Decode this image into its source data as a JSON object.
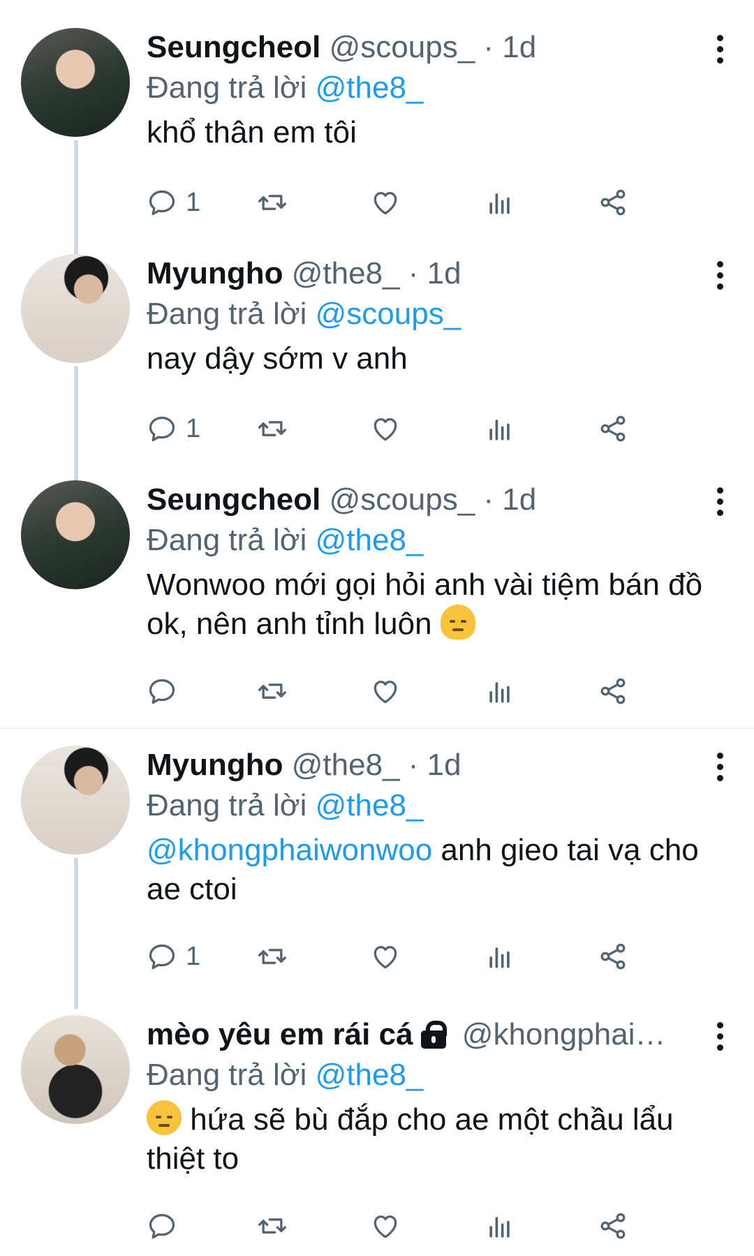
{
  "replying_prefix": "Đang trả lời",
  "colors": {
    "accent": "#1d9bf0",
    "secondary_text": "#536471",
    "icon": "#536471"
  },
  "tweets": [
    {
      "name": "Seungcheol",
      "handle": "@scoups_",
      "sep": "·",
      "time": "1d",
      "replying_to": "@the8_",
      "mention": "",
      "text": "khổ thân em tôi",
      "reply_count": "1",
      "avatar_icon": "profile-photo"
    },
    {
      "name": "Myungho",
      "handle": "@the8_",
      "sep": "·",
      "time": "1d",
      "replying_to": "@scoups_",
      "mention": "",
      "text": "nay dậy sớm v anh",
      "reply_count": "1",
      "avatar_icon": "profile-photo"
    },
    {
      "name": "Seungcheol",
      "handle": "@scoups_",
      "sep": "·",
      "time": "1d",
      "replying_to": "@the8_",
      "mention": "",
      "text": "Wonwoo mới gọi hỏi anh vài tiệm bán đồ ok, nên anh tỉnh luôn",
      "emoji_after": "melting-face-emoji",
      "reply_count": "",
      "avatar_icon": "profile-photo"
    },
    {
      "name": "Myungho",
      "handle": "@the8_",
      "sep": "·",
      "time": "1d",
      "replying_to": "@the8_",
      "mention": "@khongphaiwonwoo",
      "text": " anh gieo tai vạ cho ae ctoi",
      "reply_count": "1",
      "avatar_icon": "profile-photo"
    },
    {
      "name": "mèo yêu em rái cá",
      "handle": "@khongphai…",
      "sep": "",
      "time": "",
      "replying_to": "@the8_",
      "mention": "",
      "text": " hứa sẽ bù đắp cho ae một chầu lẩu thiệt to",
      "emoji_before": "pensive-face-emoji",
      "reply_count": "",
      "avatar_icon": "profile-photo",
      "protected_icon": "lock-icon"
    }
  ]
}
